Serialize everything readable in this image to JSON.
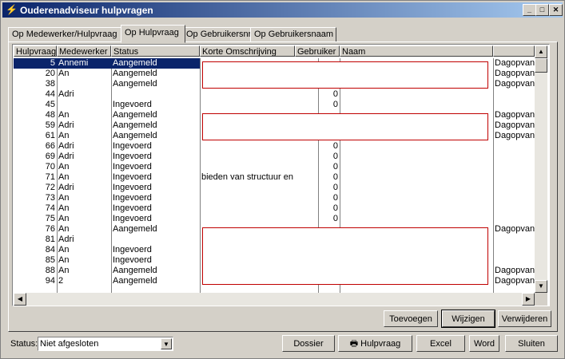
{
  "window": {
    "title": "Ouderenadviseur hulpvragen",
    "icons": {
      "app": "app-icon",
      "minimize": "minimize-icon",
      "maximize": "maximize-icon",
      "close": "close-icon"
    }
  },
  "tabs": [
    {
      "label": "Op Medewerker/Hulpvraag",
      "active": false
    },
    {
      "label": "Op Hulpvraag",
      "active": true
    },
    {
      "label": "Op Gebruikersnr",
      "active": false
    },
    {
      "label": "Op Gebruikersnaam",
      "active": false
    }
  ],
  "grid": {
    "columns": [
      "Hulpvraag",
      "Medewerker",
      "Status",
      "Korte Omschrijving",
      "Gebruiker",
      "Naam",
      ""
    ],
    "rows": [
      {
        "hulpvraag": "5",
        "medewerker": "Annemi",
        "status": "Aangemeld",
        "omschrijving": "",
        "gebruiker": "",
        "naam": "",
        "extra": "Dagopvan",
        "selected": true
      },
      {
        "hulpvraag": "20",
        "medewerker": "An",
        "status": "Aangemeld",
        "omschrijving": "",
        "gebruiker": "",
        "naam": "",
        "extra": "Dagopvan"
      },
      {
        "hulpvraag": "38",
        "medewerker": "",
        "status": "Aangemeld",
        "omschrijving": "",
        "gebruiker": "",
        "naam": "",
        "extra": "Dagopvan"
      },
      {
        "hulpvraag": "44",
        "medewerker": "Adri",
        "status": "",
        "omschrijving": "",
        "gebruiker": "0",
        "naam": "",
        "extra": ""
      },
      {
        "hulpvraag": "45",
        "medewerker": "",
        "status": "Ingevoerd",
        "omschrijving": "",
        "gebruiker": "0",
        "naam": "",
        "extra": ""
      },
      {
        "hulpvraag": "48",
        "medewerker": "An",
        "status": "Aangemeld",
        "omschrijving": "",
        "gebruiker": "",
        "naam": "",
        "extra": "Dagopvan"
      },
      {
        "hulpvraag": "59",
        "medewerker": "Adri",
        "status": "Aangemeld",
        "omschrijving": "",
        "gebruiker": "",
        "naam": "",
        "extra": "Dagopvan"
      },
      {
        "hulpvraag": "61",
        "medewerker": "An",
        "status": "Aangemeld",
        "omschrijving": "",
        "gebruiker": "",
        "naam": "",
        "extra": "Dagopvan"
      },
      {
        "hulpvraag": "66",
        "medewerker": "Adri",
        "status": "Ingevoerd",
        "omschrijving": "",
        "gebruiker": "0",
        "naam": "",
        "extra": ""
      },
      {
        "hulpvraag": "69",
        "medewerker": "Adri",
        "status": "Ingevoerd",
        "omschrijving": "",
        "gebruiker": "0",
        "naam": "",
        "extra": ""
      },
      {
        "hulpvraag": "70",
        "medewerker": "An",
        "status": "Ingevoerd",
        "omschrijving": "",
        "gebruiker": "0",
        "naam": "",
        "extra": ""
      },
      {
        "hulpvraag": "71",
        "medewerker": "An",
        "status": "Ingevoerd",
        "omschrijving": "bieden van structuur en",
        "gebruiker": "0",
        "naam": "",
        "extra": ""
      },
      {
        "hulpvraag": "72",
        "medewerker": "Adri",
        "status": "Ingevoerd",
        "omschrijving": "",
        "gebruiker": "0",
        "naam": "",
        "extra": ""
      },
      {
        "hulpvraag": "73",
        "medewerker": "An",
        "status": "Ingevoerd",
        "omschrijving": "",
        "gebruiker": "0",
        "naam": "",
        "extra": ""
      },
      {
        "hulpvraag": "74",
        "medewerker": "An",
        "status": "Ingevoerd",
        "omschrijving": "",
        "gebruiker": "0",
        "naam": "",
        "extra": ""
      },
      {
        "hulpvraag": "75",
        "medewerker": "An",
        "status": "Ingevoerd",
        "omschrijving": "",
        "gebruiker": "0",
        "naam": "",
        "extra": ""
      },
      {
        "hulpvraag": "76",
        "medewerker": "An",
        "status": "Aangemeld",
        "omschrijving": "",
        "gebruiker": "",
        "naam": "",
        "extra": "Dagopvan"
      },
      {
        "hulpvraag": "81",
        "medewerker": "Adri",
        "status": "",
        "omschrijving": "",
        "gebruiker": "",
        "naam": "",
        "extra": ""
      },
      {
        "hulpvraag": "84",
        "medewerker": "An",
        "status": "Ingevoerd",
        "omschrijving": "",
        "gebruiker": "",
        "naam": "",
        "extra": ""
      },
      {
        "hulpvraag": "85",
        "medewerker": "An",
        "status": "Ingevoerd",
        "omschrijving": "",
        "gebruiker": "",
        "naam": "",
        "extra": ""
      },
      {
        "hulpvraag": "88",
        "medewerker": "An",
        "status": "Aangemeld",
        "omschrijving": "",
        "gebruiker": "",
        "naam": "",
        "extra": "Dagopvan"
      },
      {
        "hulpvraag": "94",
        "medewerker": "2",
        "status": "Aangemeld",
        "omschrijving": "",
        "gebruiker": "",
        "naam": "",
        "extra": "Dagopvan"
      }
    ]
  },
  "actions": {
    "toevoegen": "Toevoegen",
    "wijzigen": "Wijzigen",
    "verwijderen": "Verwijderen"
  },
  "footer": {
    "status_label": "Status:",
    "status_value": "Niet afgesloten",
    "dossier": "Dossier",
    "hulpvraag": "Hulpvraag",
    "hulpvraag_icon": "printer-icon",
    "excel": "Excel",
    "word": "Word",
    "sluiten": "Sluiten"
  }
}
